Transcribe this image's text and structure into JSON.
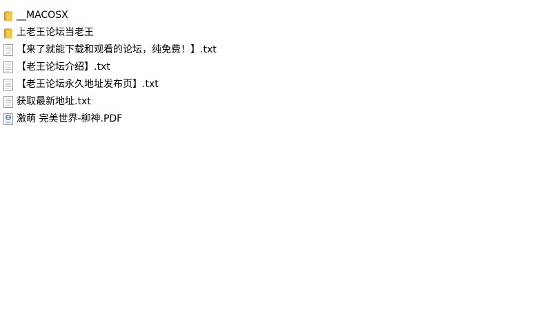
{
  "files": [
    {
      "name": "__MACOSX",
      "icon": "folder-icon"
    },
    {
      "name": "上老王论坛当老王",
      "icon": "folder-icon"
    },
    {
      "name": "【来了就能下载和观看的论坛，纯免费！】.txt",
      "icon": "text-file-icon"
    },
    {
      "name": "【老王论坛介绍】.txt",
      "icon": "text-file-icon"
    },
    {
      "name": "【老王论坛永久地址发布页】.txt",
      "icon": "text-file-icon"
    },
    {
      "name": "获取最新地址.txt",
      "icon": "text-file-icon"
    },
    {
      "name": "激萌 完美世界-柳神.PDF",
      "icon": "pdf-file-icon"
    }
  ],
  "colors": {
    "folder": "#e8b93a",
    "folder_dark": "#c99a1e",
    "text_file_border": "#9a9a9a",
    "pdf_blue": "#3b78c4"
  }
}
